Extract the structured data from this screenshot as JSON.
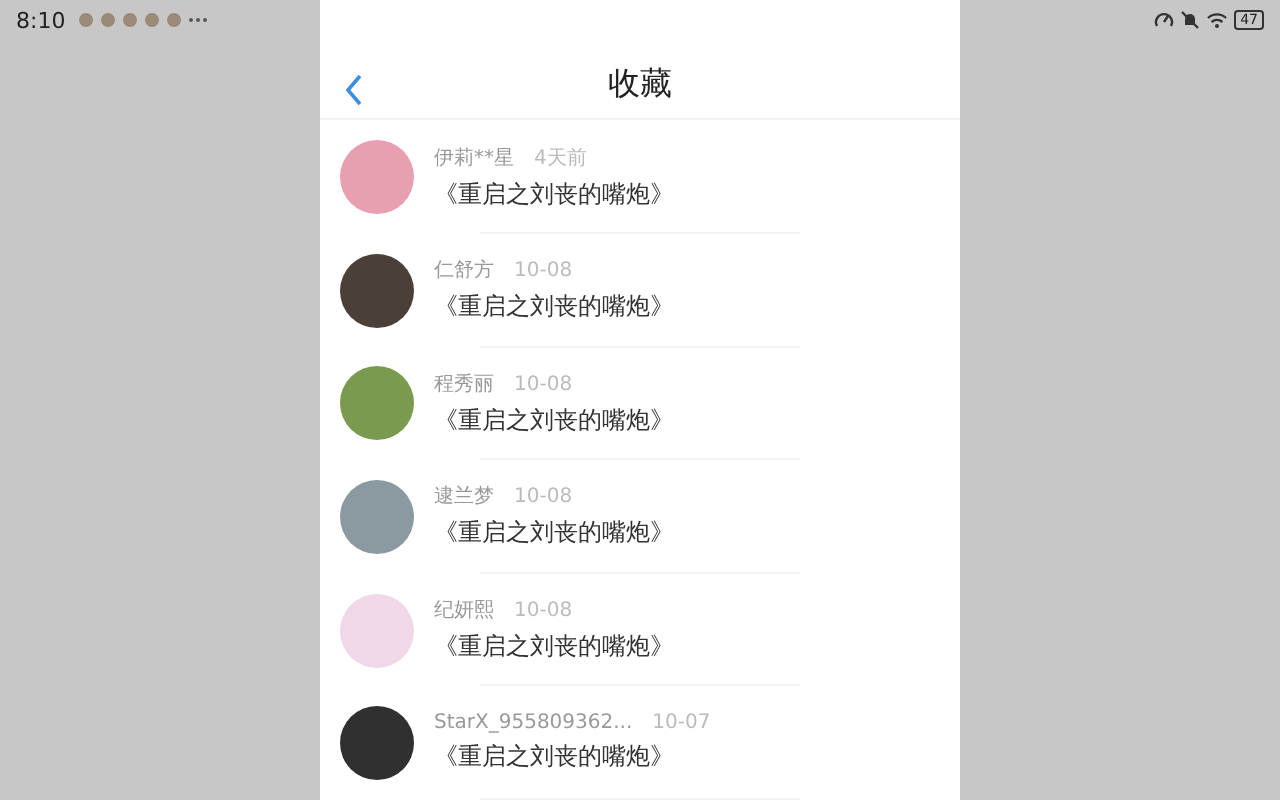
{
  "status_bar": {
    "time": "8:10",
    "battery": "47"
  },
  "header": {
    "title": "收藏"
  },
  "items": [
    {
      "user": "伊莉**星",
      "time": "4天前",
      "title": "《重启之刘丧的嘴炮》",
      "color": "#e8a0b0"
    },
    {
      "user": "仁舒方",
      "time": "10-08",
      "title": "《重启之刘丧的嘴炮》",
      "color": "#4a4038"
    },
    {
      "user": "程秀丽",
      "time": "10-08",
      "title": "《重启之刘丧的嘴炮》",
      "color": "#7a9a50"
    },
    {
      "user": "逮兰梦",
      "time": "10-08",
      "title": "《重启之刘丧的嘴炮》",
      "color": "#8a9aa0"
    },
    {
      "user": "纪妍熙",
      "time": "10-08",
      "title": "《重启之刘丧的嘴炮》",
      "color": "#f0d8e8"
    },
    {
      "user": "StarX_955809362...",
      "time": "10-07",
      "title": "《重启之刘丧的嘴炮》",
      "color": "#303030"
    }
  ]
}
